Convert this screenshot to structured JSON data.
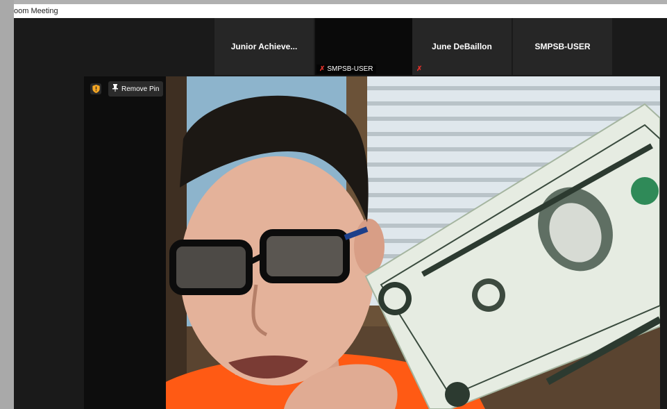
{
  "window": {
    "title": "oom Meeting"
  },
  "thumbnails": [
    {
      "name": "Junior  Achieve...",
      "tag": ""
    },
    {
      "name": "",
      "tag": "SMPSB-USER"
    },
    {
      "name": "June DeBaillon",
      "tag": ""
    },
    {
      "name": "SMPSB-USER",
      "tag": ""
    }
  ],
  "speaker": {
    "remove_pin_label": "Remove Pin"
  },
  "colors": {
    "mute": "#e0312b",
    "meeting_bg": "#1a1a1a",
    "shield": "#f5a623",
    "shirt": "#ff5a14"
  }
}
